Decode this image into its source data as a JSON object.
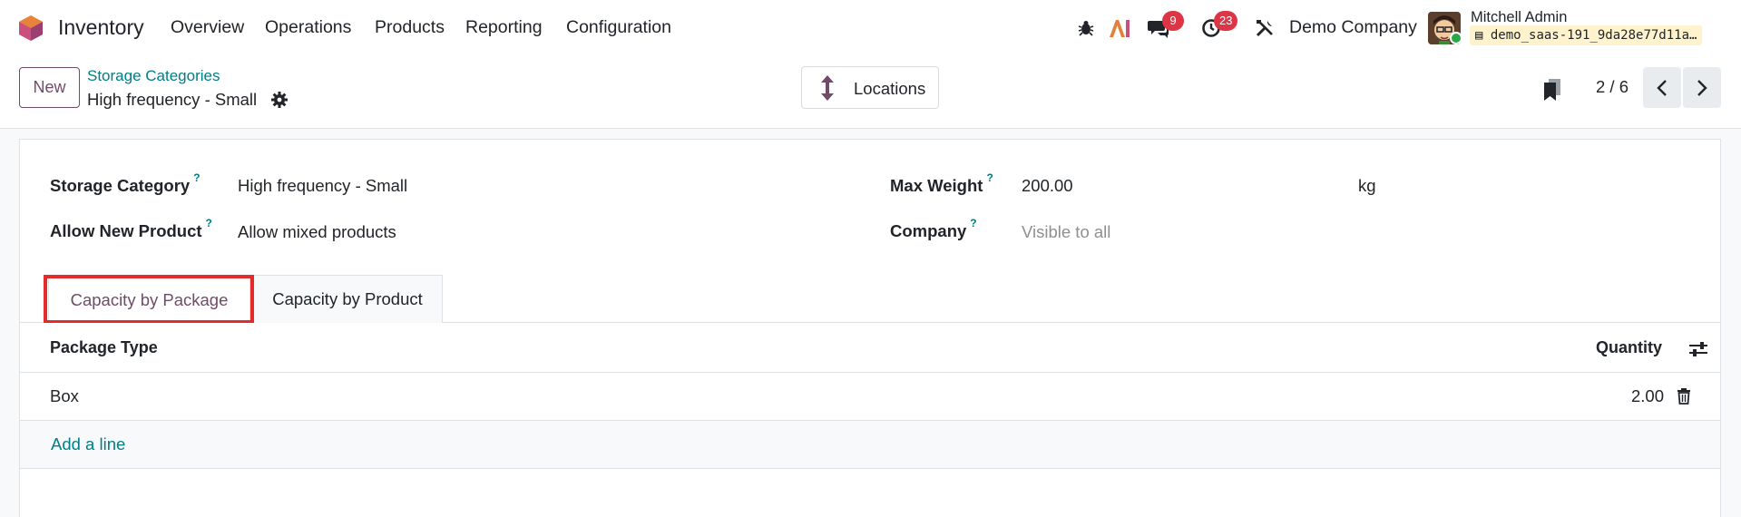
{
  "app": {
    "name": "Inventory"
  },
  "menu": [
    "Overview",
    "Operations",
    "Products",
    "Reporting",
    "Configuration"
  ],
  "systray": {
    "messages_count": "9",
    "activities_count": "23",
    "company": "Demo Company",
    "user_name": "Mitchell Admin",
    "database": "demo_saas-191_9da28e77d11a…"
  },
  "control_panel": {
    "new_label": "New",
    "breadcrumb": "Storage Categories",
    "record_title": "High frequency - Small",
    "locations_label": "Locations",
    "pager": "2 / 6"
  },
  "form": {
    "storage_category_label": "Storage Category",
    "storage_category_value": "High frequency - Small",
    "allow_new_product_label": "Allow New Product",
    "allow_new_product_value": "Allow mixed products",
    "max_weight_label": "Max Weight",
    "max_weight_value": "200.00",
    "max_weight_unit": "kg",
    "company_label": "Company",
    "company_placeholder": "Visible to all",
    "help_marker": "?"
  },
  "tabs": [
    "Capacity by Package",
    "Capacity by Product"
  ],
  "list": {
    "columns": [
      "Package Type",
      "Quantity"
    ],
    "rows": [
      {
        "package_type": "Box",
        "quantity": "2.00"
      }
    ],
    "add_line": "Add a line"
  },
  "colors": {
    "primary": "#714b67",
    "link": "#017e84",
    "badge": "#dc3545",
    "highlight": "#e32b2b"
  }
}
